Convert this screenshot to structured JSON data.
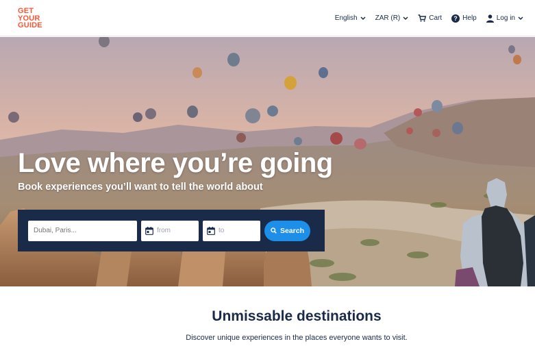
{
  "header": {
    "logo_lines": [
      "GET",
      "YOUR",
      "GUIDE"
    ],
    "nav": {
      "language": "English",
      "currency": "ZAR (R)",
      "cart": "Cart",
      "help": "Help",
      "login": "Log in"
    }
  },
  "hero": {
    "title": "Love where you’re going",
    "subtitle": "Book experiences you’ll want to tell the world about",
    "search": {
      "destination_placeholder": "Dubai, Paris...",
      "from_placeholder": "from",
      "to_placeholder": "to",
      "button_label": "Search"
    }
  },
  "section": {
    "title": "Unmissable destinations",
    "subtitle": "Discover unique experiences in the places everyone wants to visit."
  },
  "colors": {
    "brand": "#ff5533",
    "navy": "#1a2b49",
    "accent": "#1e8fe8"
  },
  "icons": [
    "chevron-down-icon",
    "cart-icon",
    "help-icon",
    "user-icon",
    "calendar-icon",
    "search-icon"
  ]
}
